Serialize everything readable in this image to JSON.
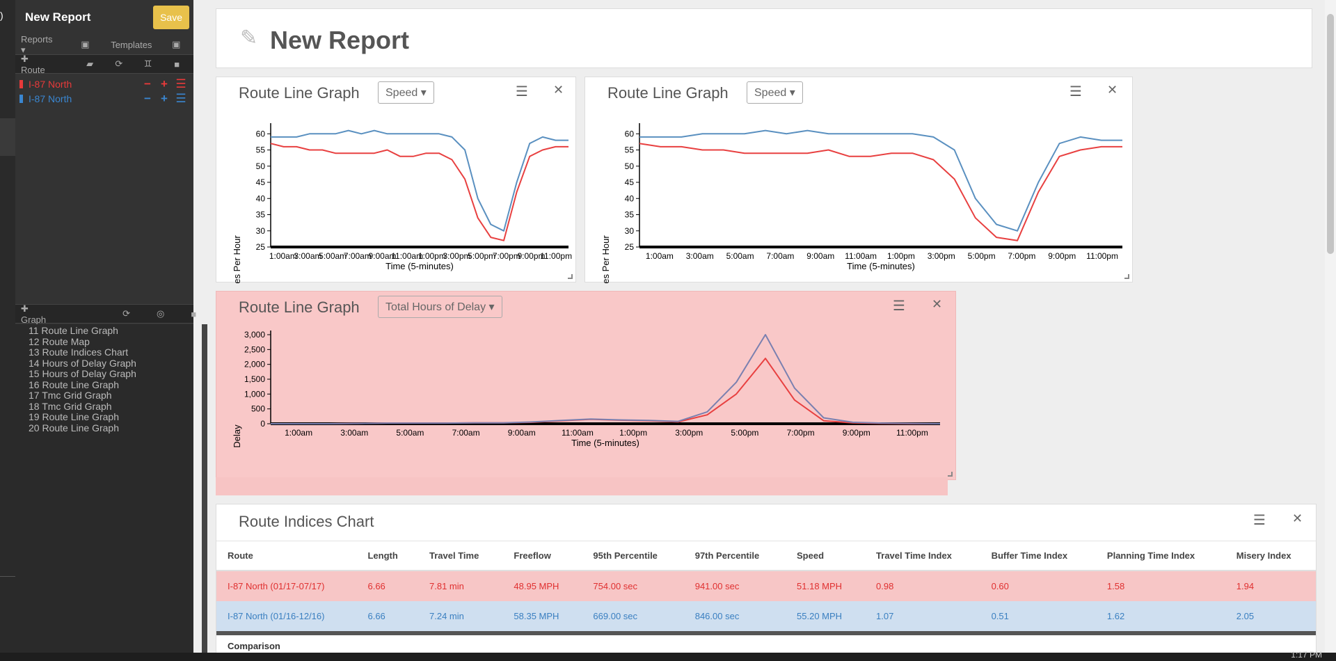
{
  "sidebar": {
    "title": "New Report",
    "save_label": "Save",
    "toolbar1": {
      "reports_label": "Reports",
      "templates_label": "Templates"
    },
    "route_bar": {
      "add_label": "Route"
    },
    "routes": [
      {
        "name": "I-87 North",
        "color": "#e83a3a"
      },
      {
        "name": "I-87 North",
        "color": "#3a86d0"
      }
    ],
    "graph_bar": {
      "add_label": "Graph"
    },
    "graphs": [
      "11 Route Line Graph",
      "12 Route Map",
      "13 Route Indices Chart",
      "14 Hours of Delay Graph",
      "15 Hours of Delay Graph",
      "16 Route Line Graph",
      "17 Tmc Grid Graph",
      "18 Tmc Grid Graph",
      "19 Route Line Graph",
      "20 Route Line Graph"
    ]
  },
  "report": {
    "title": "New Report"
  },
  "cards": [
    {
      "title": "Route Line Graph",
      "dropdown": "Speed"
    },
    {
      "title": "Route Line Graph",
      "dropdown": "Speed"
    },
    {
      "title": "Route Line Graph",
      "dropdown": "Total Hours of Delay"
    }
  ],
  "chart_data": [
    {
      "type": "line",
      "title": "",
      "xlabel": "Time (5-minutes)",
      "ylabel": "es Per Hour",
      "x_ticks": [
        "1:00am",
        "3:00am",
        "5:00am",
        "7:00am",
        "9:00am",
        "11:00am",
        "1:00pm",
        "3:00pm",
        "5:00pm",
        "7:00pm",
        "9:00pm",
        "11:00pm"
      ],
      "y_ticks": [
        25,
        30,
        35,
        40,
        45,
        50,
        55,
        60
      ],
      "ylim": [
        25,
        62
      ],
      "x": [
        0,
        1,
        2,
        3,
        4,
        5,
        6,
        7,
        8,
        9,
        10,
        11,
        12,
        13,
        14,
        15,
        16,
        17,
        18,
        19,
        20,
        21,
        22,
        23
      ],
      "series": [
        {
          "color": "#e84040",
          "values": [
            57,
            56,
            56,
            55,
            55,
            54,
            54,
            54,
            54,
            55,
            53,
            53,
            54,
            54,
            52,
            46,
            34,
            28,
            27,
            42,
            53,
            55,
            56,
            56
          ]
        },
        {
          "color": "#5a90c0",
          "values": [
            59,
            59,
            59,
            60,
            60,
            60,
            61,
            60,
            61,
            60,
            60,
            60,
            60,
            60,
            59,
            55,
            40,
            32,
            30,
            45,
            57,
            59,
            58,
            58
          ]
        }
      ]
    },
    {
      "type": "line",
      "title": "",
      "xlabel": "Time (5-minutes)",
      "ylabel": "es Per Hour",
      "x_ticks": [
        "1:00am",
        "3:00am",
        "5:00am",
        "7:00am",
        "9:00am",
        "11:00am",
        "1:00pm",
        "3:00pm",
        "5:00pm",
        "7:00pm",
        "9:00pm",
        "11:00pm"
      ],
      "y_ticks": [
        25,
        30,
        35,
        40,
        45,
        50,
        55,
        60
      ],
      "ylim": [
        25,
        62
      ],
      "x": [
        0,
        1,
        2,
        3,
        4,
        5,
        6,
        7,
        8,
        9,
        10,
        11,
        12,
        13,
        14,
        15,
        16,
        17,
        18,
        19,
        20,
        21,
        22,
        23
      ],
      "series": [
        {
          "color": "#e84040",
          "values": [
            57,
            56,
            56,
            55,
            55,
            54,
            54,
            54,
            54,
            55,
            53,
            53,
            54,
            54,
            52,
            46,
            34,
            28,
            27,
            42,
            53,
            55,
            56,
            56
          ]
        },
        {
          "color": "#5a90c0",
          "values": [
            59,
            59,
            59,
            60,
            60,
            60,
            61,
            60,
            61,
            60,
            60,
            60,
            60,
            60,
            59,
            55,
            40,
            32,
            30,
            45,
            57,
            59,
            58,
            58
          ]
        }
      ]
    },
    {
      "type": "line",
      "title": "",
      "xlabel": "Time (5-minutes)",
      "ylabel": "Delay",
      "x_ticks": [
        "1:00am",
        "3:00am",
        "5:00am",
        "7:00am",
        "9:00am",
        "11:00am",
        "1:00pm",
        "3:00pm",
        "5:00pm",
        "7:00pm",
        "9:00pm",
        "11:00pm"
      ],
      "y_ticks": [
        "0",
        "500",
        "1,000",
        "1,500",
        "2,000",
        "2,500",
        "3,000"
      ],
      "ylim": [
        0,
        3000
      ],
      "x": [
        0,
        1,
        2,
        3,
        4,
        5,
        6,
        7,
        8,
        9,
        10,
        11,
        12,
        13,
        14,
        15,
        16,
        17,
        18,
        19,
        20,
        21,
        22,
        23
      ],
      "series": [
        {
          "color": "#e84040",
          "values": [
            0,
            0,
            0,
            10,
            20,
            20,
            20,
            30,
            30,
            50,
            100,
            150,
            120,
            100,
            60,
            300,
            1000,
            2200,
            800,
            100,
            30,
            10,
            0,
            0
          ]
        },
        {
          "color": "#7a80b0",
          "values": [
            0,
            0,
            0,
            10,
            20,
            20,
            20,
            30,
            30,
            60,
            110,
            160,
            130,
            110,
            80,
            400,
            1400,
            3000,
            1200,
            200,
            50,
            20,
            10,
            0
          ]
        }
      ]
    }
  ],
  "indices": {
    "title": "Route Indices Chart",
    "columns": [
      "Route",
      "Length",
      "Travel Time",
      "Freeflow",
      "95th Percentile",
      "97th Percentile",
      "Speed",
      "Travel Time Index",
      "Buffer Time Index",
      "Planning Time Index",
      "Misery Index"
    ],
    "rows": [
      [
        "I-87 North (01/17-07/17)",
        "6.66",
        "7.81 min",
        "48.95 MPH",
        "754.00 sec",
        "941.00 sec",
        "51.18 MPH",
        "0.98",
        "0.60",
        "1.58",
        "1.94"
      ],
      [
        "I-87 North (01/16-12/16)",
        "6.66",
        "7.24 min",
        "58.35 MPH",
        "669.00 sec",
        "846.00 sec",
        "55.20 MPH",
        "1.07",
        "0.51",
        "1.62",
        "2.05"
      ]
    ],
    "comparison_label": "Comparison"
  },
  "clock": "1:17 PM"
}
